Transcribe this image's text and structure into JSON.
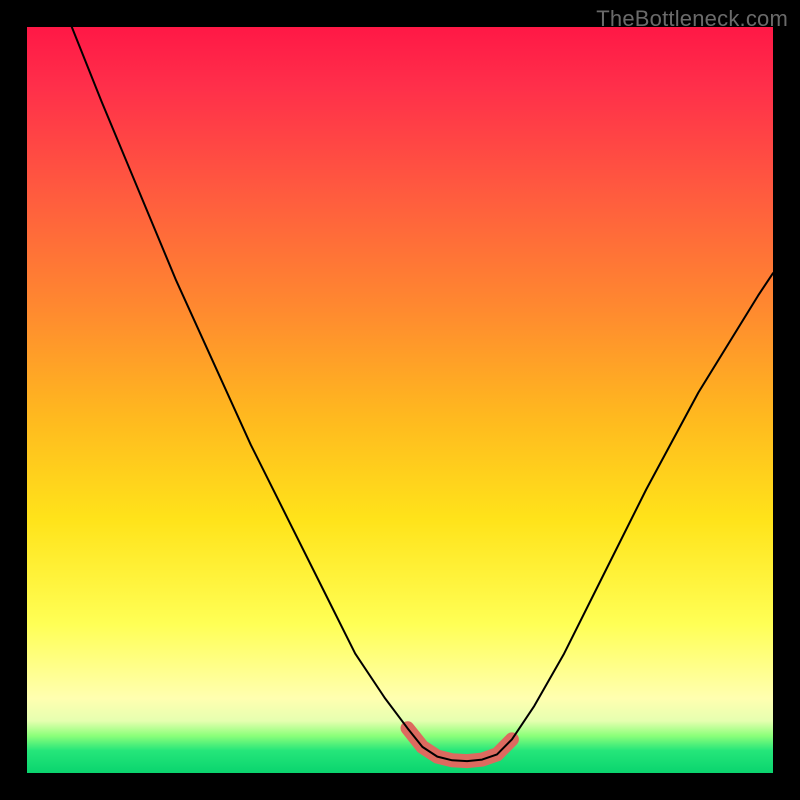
{
  "watermark": "TheBottleneck.com",
  "colors": {
    "frame": "#000000",
    "curve": "#000000",
    "valley_highlight": "#dd6a5f",
    "gradient_top": "#ff1846",
    "gradient_bottom": "#0ad46e"
  },
  "chart_data": {
    "type": "line",
    "title": "",
    "xlabel": "",
    "ylabel": "",
    "xlim": [
      0,
      100
    ],
    "ylim": [
      0,
      100
    ],
    "grid": false,
    "note": "x/y in percent of plot area; y=0 is top of gradient (worst), y=100 is bottom (best). Curve shows a V-shaped valley with flat minimum around x≈55–63. Valley floor highlighted by thick salmon stroke.",
    "series": [
      {
        "name": "bottleneck_curve",
        "x": [
          6,
          10,
          15,
          20,
          25,
          30,
          35,
          40,
          44,
          48,
          51,
          53,
          55,
          57,
          59,
          61,
          63,
          65,
          68,
          72,
          77,
          83,
          90,
          98,
          100
        ],
        "y": [
          0,
          10,
          22,
          34,
          45,
          56,
          66,
          76,
          84,
          90,
          94,
          96.5,
          97.8,
          98.3,
          98.4,
          98.2,
          97.5,
          95.5,
          91,
          84,
          74,
          62,
          49,
          36,
          33
        ]
      }
    ],
    "valley_highlight": {
      "x": [
        51,
        53,
        55,
        57,
        59,
        61,
        63,
        65
      ],
      "y": [
        94,
        96.5,
        97.8,
        98.3,
        98.4,
        98.2,
        97.5,
        95.5
      ]
    }
  }
}
